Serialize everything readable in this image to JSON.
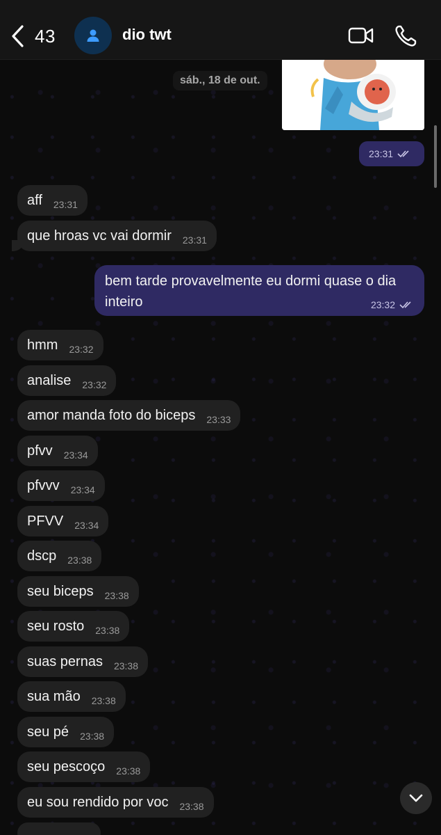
{
  "header": {
    "back_count": "43",
    "contact_name": "dio twt"
  },
  "conversation": {
    "date_label": "sáb., 18 de out.",
    "image_time": "23:31",
    "outgoing_long": {
      "text": "bem tarde provavelmente eu dormi quase o dia inteiro",
      "time": "23:32"
    },
    "incoming": [
      {
        "text": "aff",
        "time": "23:31"
      },
      {
        "text": "que hroas vc vai dormir",
        "time": "23:31"
      },
      {
        "text": "hmm",
        "time": "23:32"
      },
      {
        "text": "analise",
        "time": "23:32"
      },
      {
        "text": "amor manda foto do biceps",
        "time": "23:33"
      },
      {
        "text": "pfvv",
        "time": "23:34"
      },
      {
        "text": "pfvvv",
        "time": "23:34"
      },
      {
        "text": "PFVV",
        "time": "23:34"
      },
      {
        "text": "dscp",
        "time": "23:38"
      },
      {
        "text": "seu biceps",
        "time": "23:38"
      },
      {
        "text": "seu rosto",
        "time": "23:38"
      },
      {
        "text": "suas pernas",
        "time": "23:38"
      },
      {
        "text": "sua mão",
        "time": "23:38"
      },
      {
        "text": "seu pé",
        "time": "23:38"
      },
      {
        "text": "seu pescoço",
        "time": "23:38"
      },
      {
        "text": "eu sou rendido por voc",
        "time": "23:38"
      }
    ]
  },
  "colors": {
    "incoming_bubble": "#212121",
    "outgoing_bubble": "#2f2a63",
    "header_bg": "#161616"
  },
  "icons": [
    "chevron-left-icon",
    "person-icon",
    "video-camera-icon",
    "phone-icon",
    "double-check-icon",
    "chevron-down-icon"
  ]
}
